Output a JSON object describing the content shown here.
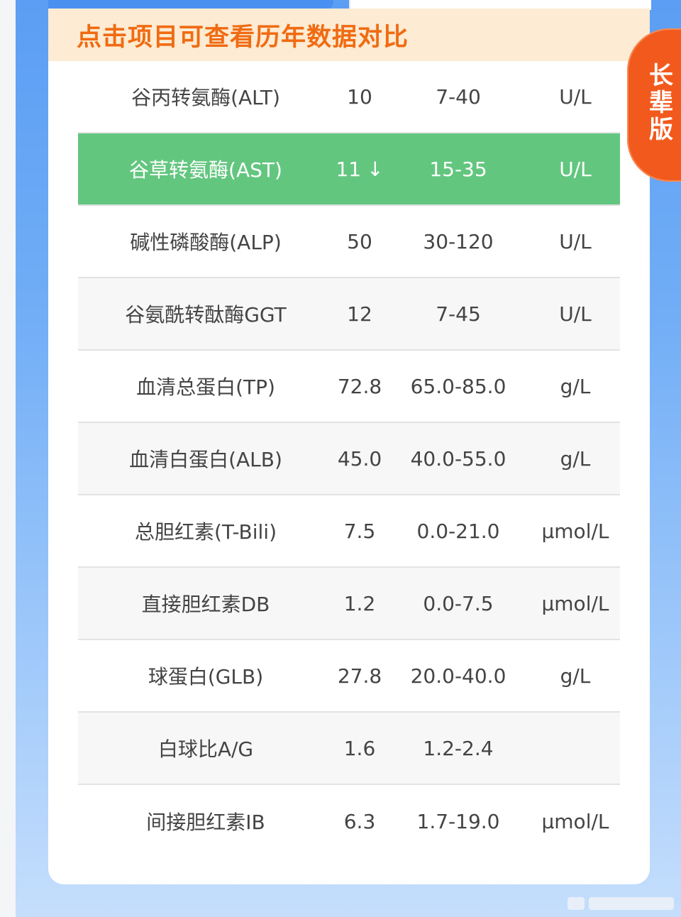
{
  "header": {
    "title": "点击项目可查看历年数据对比"
  },
  "side_button": {
    "label": "长辈版"
  },
  "colors": {
    "accent_orange": "#f06b12",
    "header_bg": "#fdebd3",
    "abnormal_row": "#63c67f",
    "side_button": "#f25a1d"
  },
  "rows": [
    {
      "name": "谷丙转氨酶(ALT)",
      "value": "10",
      "arrow": "",
      "range": "7-40",
      "unit": "U/L",
      "abnormal": false
    },
    {
      "name": "谷草转氨酶(AST)",
      "value": "11",
      "arrow": "↓",
      "range": "15-35",
      "unit": "U/L",
      "abnormal": true
    },
    {
      "name": "碱性磷酸酶(ALP)",
      "value": "50",
      "arrow": "",
      "range": "30-120",
      "unit": "U/L",
      "abnormal": false
    },
    {
      "name": "谷氨酰转酞酶GGT",
      "value": "12",
      "arrow": "",
      "range": "7-45",
      "unit": "U/L",
      "abnormal": false
    },
    {
      "name": "血清总蛋白(TP)",
      "value": "72.8",
      "arrow": "",
      "range": "65.0-85.0",
      "unit": "g/L",
      "abnormal": false
    },
    {
      "name": "血清白蛋白(ALB)",
      "value": "45.0",
      "arrow": "",
      "range": "40.0-55.0",
      "unit": "g/L",
      "abnormal": false
    },
    {
      "name": "总胆红素(T-Bili)",
      "value": "7.5",
      "arrow": "",
      "range": "0.0-21.0",
      "unit": "μmol/L",
      "abnormal": false
    },
    {
      "name": "直接胆红素DB",
      "value": "1.2",
      "arrow": "",
      "range": "0.0-7.5",
      "unit": "μmol/L",
      "abnormal": false
    },
    {
      "name": "球蛋白(GLB)",
      "value": "27.8",
      "arrow": "",
      "range": "20.0-40.0",
      "unit": "g/L",
      "abnormal": false
    },
    {
      "name": "白球比A/G",
      "value": "1.6",
      "arrow": "",
      "range": "1.2-2.4",
      "unit": "",
      "abnormal": false
    },
    {
      "name": "间接胆红素IB",
      "value": "6.3",
      "arrow": "",
      "range": "1.7-19.0",
      "unit": "μmol/L",
      "abnormal": false
    }
  ]
}
